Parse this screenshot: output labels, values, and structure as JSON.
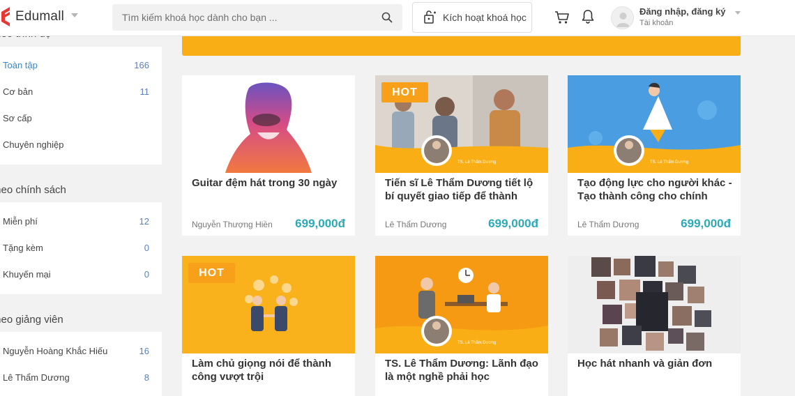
{
  "header": {
    "logo_text": "Edumall",
    "search_placeholder": "Tìm kiếm khoá học dành cho bạn ...",
    "activate_label": "Kích hoạt khoá học",
    "user_title": "Đăng nhập, đăng ký",
    "user_subtitle": "Tài khoản"
  },
  "sidebar": {
    "level_heading": "Theo trình độ",
    "level_items": [
      {
        "label": "Toàn tập",
        "count": "166"
      },
      {
        "label": "Cơ bản",
        "count": "11"
      },
      {
        "label": "Sơ cấp",
        "count": ""
      },
      {
        "label": "Chuyên nghiệp",
        "count": ""
      }
    ],
    "policy_heading": "Theo chính sách",
    "policy_items": [
      {
        "label": "Miễn phí",
        "count": "12"
      },
      {
        "label": "Tặng kèm",
        "count": "0"
      },
      {
        "label": "Khuyến mại",
        "count": "0"
      }
    ],
    "teacher_heading": "Theo giảng viên",
    "teacher_items": [
      {
        "label": "Nguyễn Hoàng Khắc Hiếu",
        "count": "16"
      },
      {
        "label": "Lê Thẩm Dương",
        "count": "8"
      }
    ]
  },
  "courses": [
    {
      "title": "Guitar đệm hát trong 30 ngày",
      "author": "Nguyễn Thượng Hiền",
      "price": "699,000đ",
      "badge": ""
    },
    {
      "title": "Tiến sĩ Lê Thẩm Dương tiết lộ bí quyết giao tiếp để thành",
      "author": "Lê Thẩm Dương",
      "price": "699,000đ",
      "badge": "HOT",
      "caption": "TS. Lê Thẩm Dương"
    },
    {
      "title": "Tạo động lực cho người khác - Tạo thành công cho chính",
      "author": "Lê Thẩm Dương",
      "price": "699,000đ",
      "badge": "",
      "caption": "TS. Lê Thẩm Dương"
    },
    {
      "title": "Làm chủ giọng nói để thành công vượt trội",
      "author": "",
      "price": "",
      "badge": "HOT"
    },
    {
      "title": "TS. Lê Thẩm Dương: Lãnh đạo là một nghề phải học",
      "author": "",
      "price": "",
      "badge": "",
      "caption": "TS. Lê Thẩm Dương"
    },
    {
      "title": "Học hát nhanh và giản đơn",
      "author": "",
      "price": "",
      "badge": ""
    }
  ],
  "colors": {
    "accent": "#f9ae15",
    "price": "#2ba9b6",
    "link_active": "#3a86c8"
  }
}
